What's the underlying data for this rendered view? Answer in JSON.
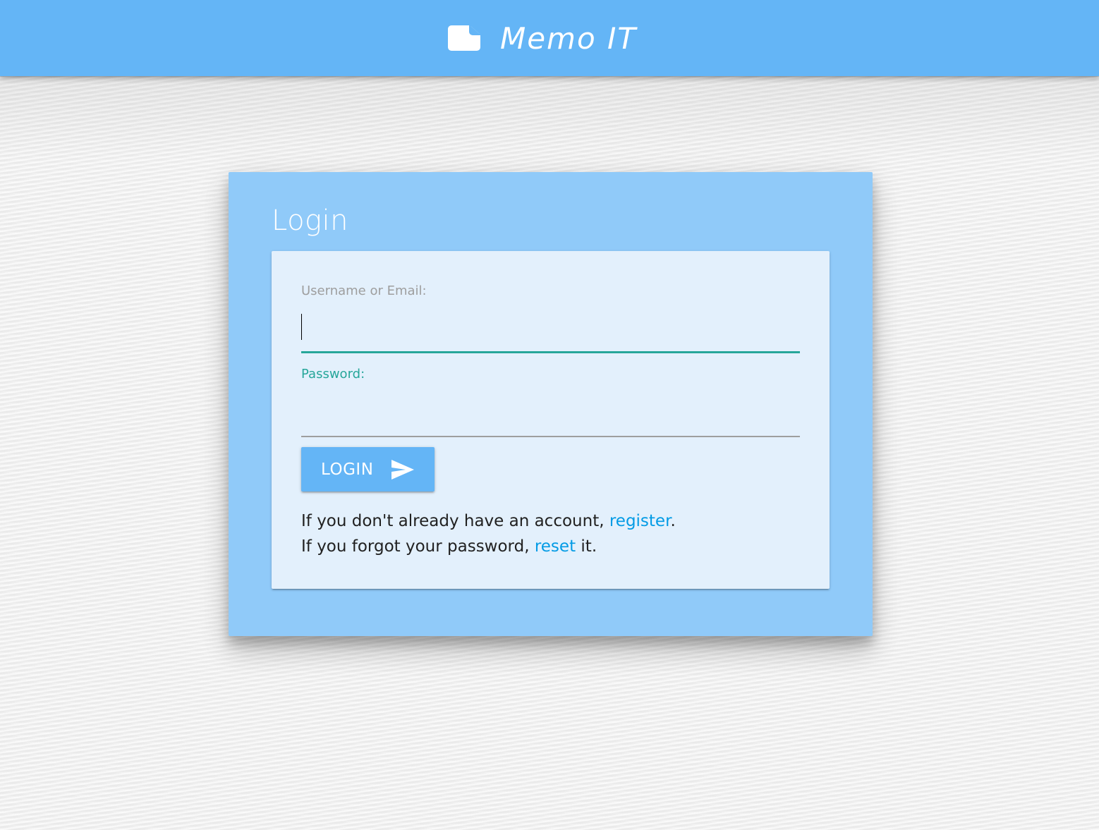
{
  "app": {
    "title": "Memo IT",
    "brand_icon": "note-icon"
  },
  "colors": {
    "primary": "#64b5f6",
    "card": "#90caf9",
    "panel": "#e3f0fc",
    "accent": "#26a69a",
    "link": "#039be5"
  },
  "login": {
    "title": "Login",
    "username_label": "Username or Email:",
    "username_value": "",
    "password_label": "Password:",
    "password_value": "",
    "button_label": "LOGIN",
    "button_icon": "send-icon",
    "register_prefix": "If you don't already have an account, ",
    "register_link": "register",
    "register_suffix": ".",
    "reset_prefix": "If you forgot your password, ",
    "reset_link": "reset",
    "reset_suffix": " it."
  }
}
